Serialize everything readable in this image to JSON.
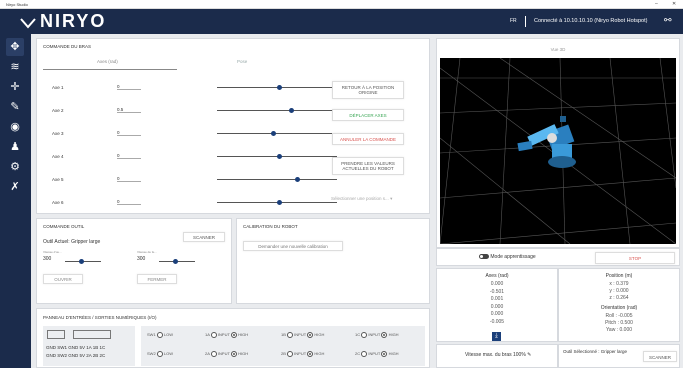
{
  "window": {
    "title": "Niryo Studio",
    "min": "–",
    "close": "✕"
  },
  "header": {
    "logo": "NIRYO",
    "lang": "FR",
    "connection": "Connecté à 10.10.10.10 (Niryo Robot Hotspot)"
  },
  "arm": {
    "title": "Commande du bras",
    "tabs": [
      "Axes (rad)",
      "Pose"
    ],
    "axes": [
      {
        "label": "Axe 1",
        "value": "0",
        "position": 0.5
      },
      {
        "label": "Axe 2",
        "value": "0.5",
        "position": 0.6
      },
      {
        "label": "Axe 3",
        "value": "0",
        "position": 0.45
      },
      {
        "label": "Axe 4",
        "value": "0",
        "position": 0.5
      },
      {
        "label": "Axe 5",
        "value": "0",
        "position": 0.65
      },
      {
        "label": "Axe 6",
        "value": "0",
        "position": 0.5
      }
    ],
    "buttons": {
      "home": "RETOUR À LA POSITION ORIGINE",
      "move": "DÉPLACER AXES",
      "cancel": "ANNULER LA COMMANDE",
      "take": "PRENDRE LES VALEURS ACTUELLES DU ROBOT"
    },
    "position_select": "Sélectionner une position s..."
  },
  "tool": {
    "title": "Commande outil",
    "scan": "SCANNER",
    "current_label": "Outil Actuel:",
    "current": "Gripper large",
    "speed_open_label": "Vitesse d'ou...",
    "speed_open": "300",
    "speed_close_label": "Vitesse de fe...",
    "speed_close": "300",
    "open": "OUVRIR",
    "close": "FERMER"
  },
  "calibration": {
    "title": "Calibration du robot",
    "request": "Demander une nouvelle calibration"
  },
  "io": {
    "title": "Panneau d'entrées / sorties numériques (I/O)",
    "left_labels": [
      "GND SW1 GND 5V 1A 1B 1C",
      "GND SW2 GND 5V 2A 2B 2C"
    ],
    "rows": [
      [
        "SW1",
        "1A",
        "1B",
        "1C"
      ],
      [
        "SW2",
        "2A",
        "2B",
        "2C"
      ]
    ],
    "low": "LOW",
    "input": "INPUT",
    "high": "HIGH"
  },
  "view3d": {
    "title": "Vue 3D"
  },
  "status": {
    "learning_mode": "Mode apprentissage",
    "stop": "STOP",
    "axes_title": "Axes (rad)",
    "axes_values": [
      "0.000",
      "-0.501",
      "0.001",
      "0.000",
      "0.000",
      "-0.005"
    ],
    "pos_title": "Position (m)",
    "pos_values": [
      "x : 0.379",
      "y : 0.000",
      "z : 0.264"
    ],
    "orient_title": "Orientation (rad)",
    "orient_values": [
      "Roll : -0.005",
      "Pitch : 0.500",
      "Yaw : 0.000"
    ],
    "max_speed": "Vitesse max. du bras 100%",
    "tool_selected_label": "Outil Sélectionné :",
    "tool_selected": "Gripper large",
    "scan": "SCANNER"
  },
  "colors": {
    "navy": "#1b2b4b",
    "green": "#3aa655",
    "red": "#d9534f",
    "grid": "#555555"
  }
}
